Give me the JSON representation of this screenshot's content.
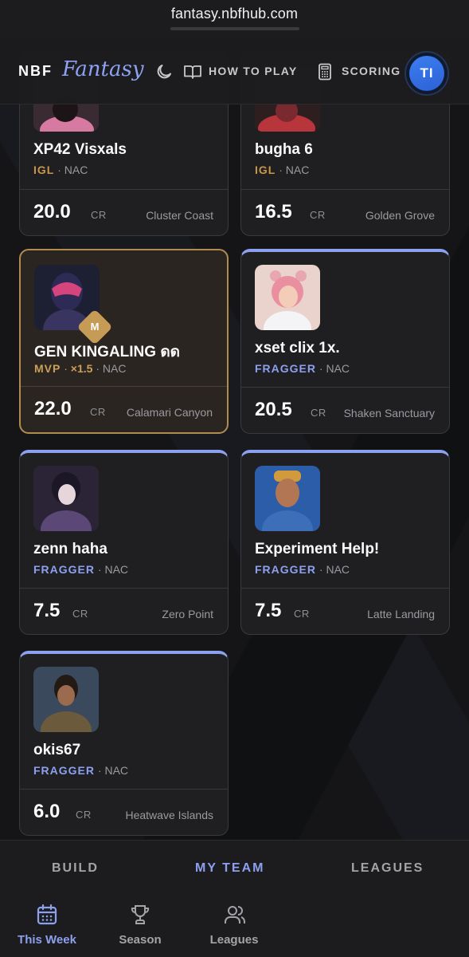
{
  "browser": {
    "url": "fantasy.nbfhub.com"
  },
  "header": {
    "brand_primary": "NBF",
    "brand_secondary": "Fantasy",
    "how_to_play": "HOW TO PLAY",
    "scoring": "SCORING",
    "avatar_initials": "TI"
  },
  "cards": [
    {
      "name": "XP42 Visxals",
      "role": "IGL",
      "region": "NAC",
      "points": "20.0",
      "cr": "CR",
      "map": "Cluster Coast"
    },
    {
      "name": "bugha 6",
      "role": "IGL",
      "region": "NAC",
      "points": "16.5",
      "cr": "CR",
      "map": "Golden Grove"
    },
    {
      "name": "GEN KINGALING ดด",
      "role": "MVP",
      "multiplier": "×1.5",
      "region": "NAC",
      "points": "22.0",
      "cr": "CR",
      "map": "Calamari Canyon",
      "badge": "M"
    },
    {
      "name": "xset clix 1x.",
      "role": "FRAGGER",
      "region": "NAC",
      "points": "20.5",
      "cr": "CR",
      "map": "Shaken Sanctuary"
    },
    {
      "name": "zenn haha",
      "role": "FRAGGER",
      "region": "NAC",
      "points": "7.5",
      "cr": "CR",
      "map": "Zero Point"
    },
    {
      "name": "Experiment Help!",
      "role": "FRAGGER",
      "region": "NAC",
      "points": "7.5",
      "cr": "CR",
      "map": "Latte Landing"
    },
    {
      "name": "okis67",
      "role": "FRAGGER",
      "region": "NAC",
      "points": "6.0",
      "cr": "CR",
      "map": "Heatwave Islands"
    }
  ],
  "top_tabs": {
    "build": "BUILD",
    "my_team": "MY TEAM",
    "leagues": "LEAGUES"
  },
  "bottom_nav": {
    "this_week": "This Week",
    "season": "Season",
    "leagues": "Leagues"
  },
  "separator": "·",
  "colors": {
    "accent": "#8da0ef",
    "gold": "#c8974a",
    "background": "#151517"
  }
}
